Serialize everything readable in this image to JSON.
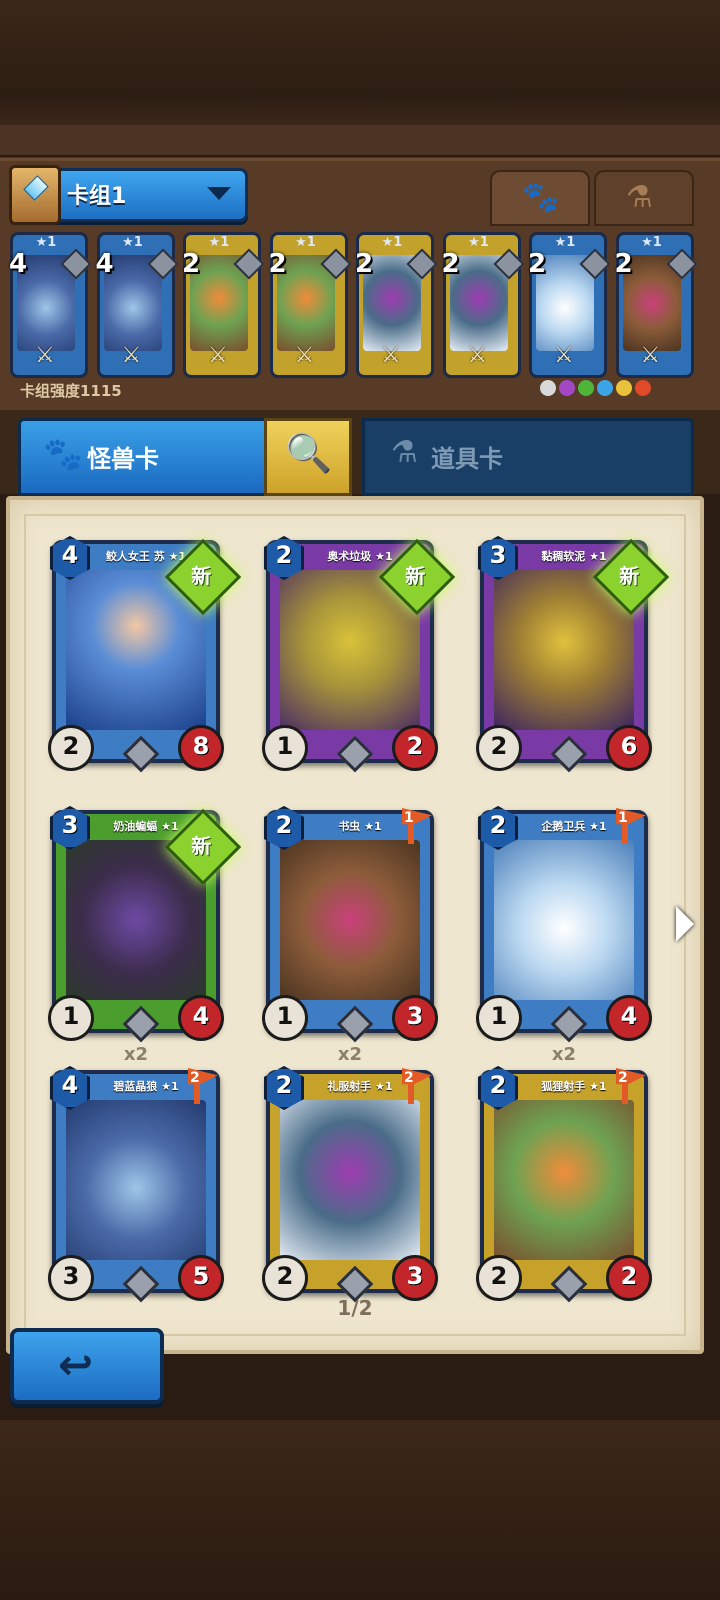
{
  "deck": {
    "name": "卡组1",
    "power_label": "卡组强度1115",
    "mini_cards": [
      {
        "cost": "4",
        "stars": "★1",
        "color": "blue"
      },
      {
        "cost": "4",
        "stars": "★1",
        "color": "blue"
      },
      {
        "cost": "2",
        "stars": "★1",
        "color": "gold"
      },
      {
        "cost": "2",
        "stars": "★1",
        "color": "gold"
      },
      {
        "cost": "2",
        "stars": "★1",
        "color": "gold"
      },
      {
        "cost": "2",
        "stars": "★1",
        "color": "gold"
      },
      {
        "cost": "2",
        "stars": "★1",
        "color": "blue"
      },
      {
        "cost": "2",
        "stars": "★1",
        "color": "blue"
      }
    ],
    "faction_colors": [
      "#d9d9d9",
      "#a347c4",
      "#4fb43a",
      "#3aa6e8",
      "#e8c23a",
      "#e04a2a"
    ]
  },
  "tabs": {
    "monster": "怪兽卡",
    "item": "道具卡"
  },
  "icons": {
    "paw": "paw-icon",
    "potion": "potion-icon",
    "search": "search-icon",
    "back": "back-arrow-icon"
  },
  "cards": [
    {
      "title": "鲛人女王 苏 ★1",
      "cost": "4",
      "atk": "2",
      "hp": "8",
      "badge": "新",
      "color": "blue",
      "art": "art-mermaid"
    },
    {
      "title": "奥术垃圾 ★1",
      "cost": "2",
      "atk": "1",
      "hp": "2",
      "badge": "新",
      "color": "purple",
      "art": "art-trash"
    },
    {
      "title": "黏稠软泥 ★1",
      "cost": "3",
      "atk": "2",
      "hp": "6",
      "badge": "新",
      "color": "purple",
      "art": "art-slime"
    },
    {
      "title": "奶油蝙蝠 ★1",
      "cost": "3",
      "atk": "1",
      "hp": "4",
      "badge": "新",
      "color": "green",
      "art": "art-bat"
    },
    {
      "title": "书虫 ★1",
      "cost": "2",
      "atk": "1",
      "hp": "3",
      "flag": "1",
      "color": "blue",
      "art": "art-worm"
    },
    {
      "title": "企鹅卫兵 ★1",
      "cost": "2",
      "atk": "1",
      "hp": "4",
      "flag": "1",
      "color": "blue",
      "art": "art-penguin"
    },
    {
      "title": "碧蓝晶狼 ★1",
      "cost": "4",
      "atk": "3",
      "hp": "5",
      "flag": "2",
      "dup": "x2",
      "color": "blue",
      "art": "art-wolf"
    },
    {
      "title": "礼服射手 ★1",
      "cost": "2",
      "atk": "2",
      "hp": "3",
      "flag": "2",
      "dup": "x2",
      "color": "gold",
      "art": "art-bird"
    },
    {
      "title": "狐狸射手 ★1",
      "cost": "2",
      "atk": "2",
      "hp": "2",
      "flag": "2",
      "dup": "x2",
      "color": "gold",
      "art": "art-fox"
    }
  ],
  "pagination": "1/2"
}
